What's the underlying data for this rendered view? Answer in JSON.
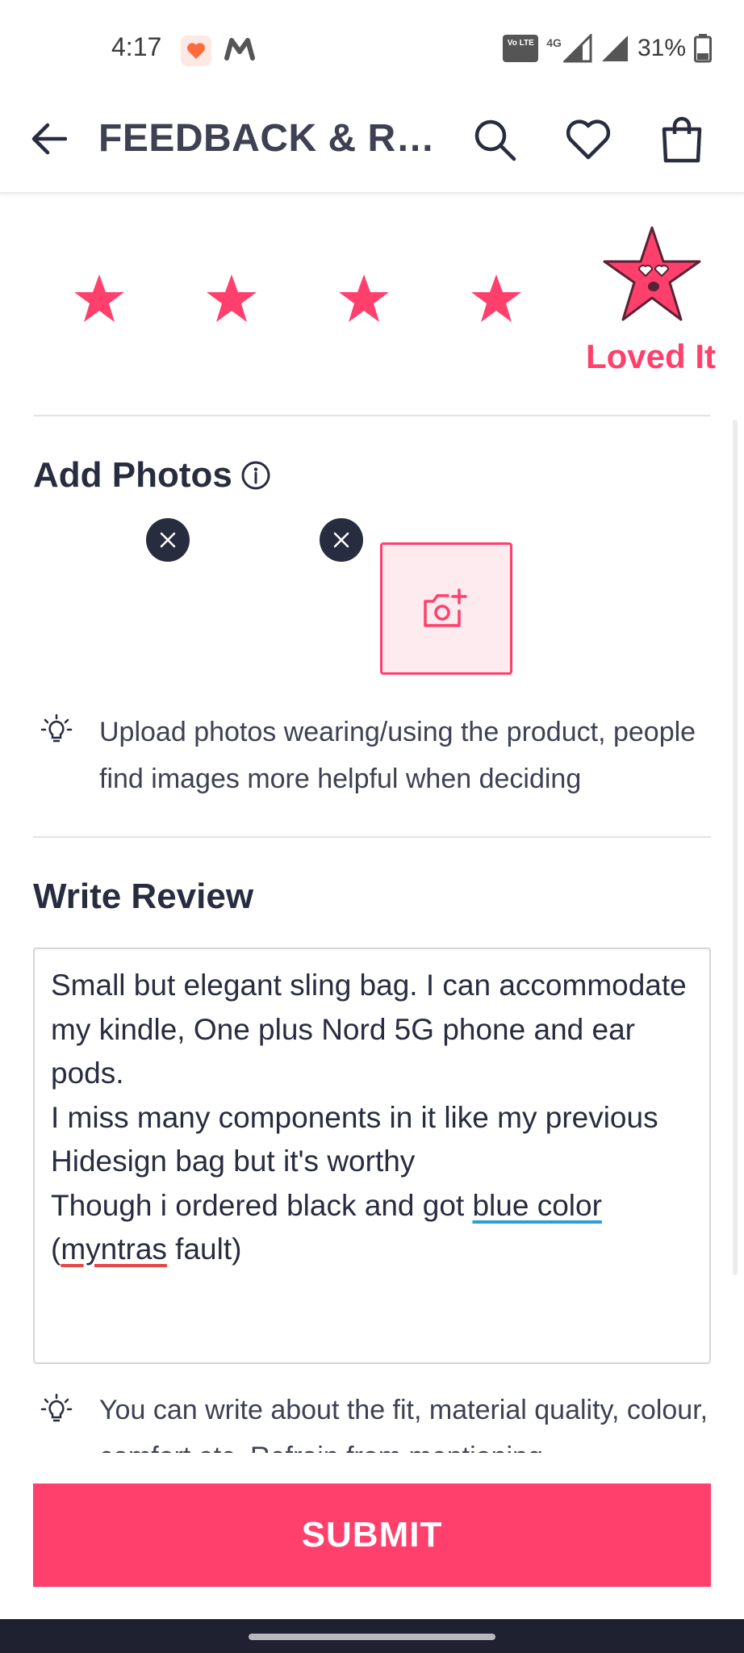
{
  "status_bar": {
    "time": "4:17",
    "network_type": "4G",
    "volte_label": "Vo LTE",
    "battery": "31%",
    "icons": [
      "heart-app-icon",
      "gmail-icon",
      "volte-icon",
      "signal-icon",
      "signal-icon",
      "battery-icon"
    ]
  },
  "header": {
    "title": "FEEDBACK & REVIEW",
    "icons": [
      "back-arrow-icon",
      "search-icon",
      "wishlist-heart-icon",
      "bag-icon"
    ]
  },
  "rating": {
    "selected": 5,
    "max": 5,
    "selected_label": "Loved It",
    "accent_color": "#ff3f6c"
  },
  "add_photos": {
    "title": "Add Photos",
    "uploaded_count": 2,
    "tip": "Upload photos wearing/using the product, people find images more helpful when deciding"
  },
  "write_review": {
    "title": "Write Review",
    "text_part1": "Small but elegant sling bag. I can accommodate my kindle, One plus Nord 5G phone and ear pods.\nI miss many components in it like my previous Hidesign bag but it's worthy\nThough i ordered black and got ",
    "text_blue_underlined": "blue color",
    "text_part2": "\n(",
    "text_red_underlined": "myntras",
    "text_part3": " fault)",
    "tip": "You can write about the fit, material quality, colour, comfort etc. Refrain from mentioning"
  },
  "submit": {
    "label": "SUBMIT"
  }
}
